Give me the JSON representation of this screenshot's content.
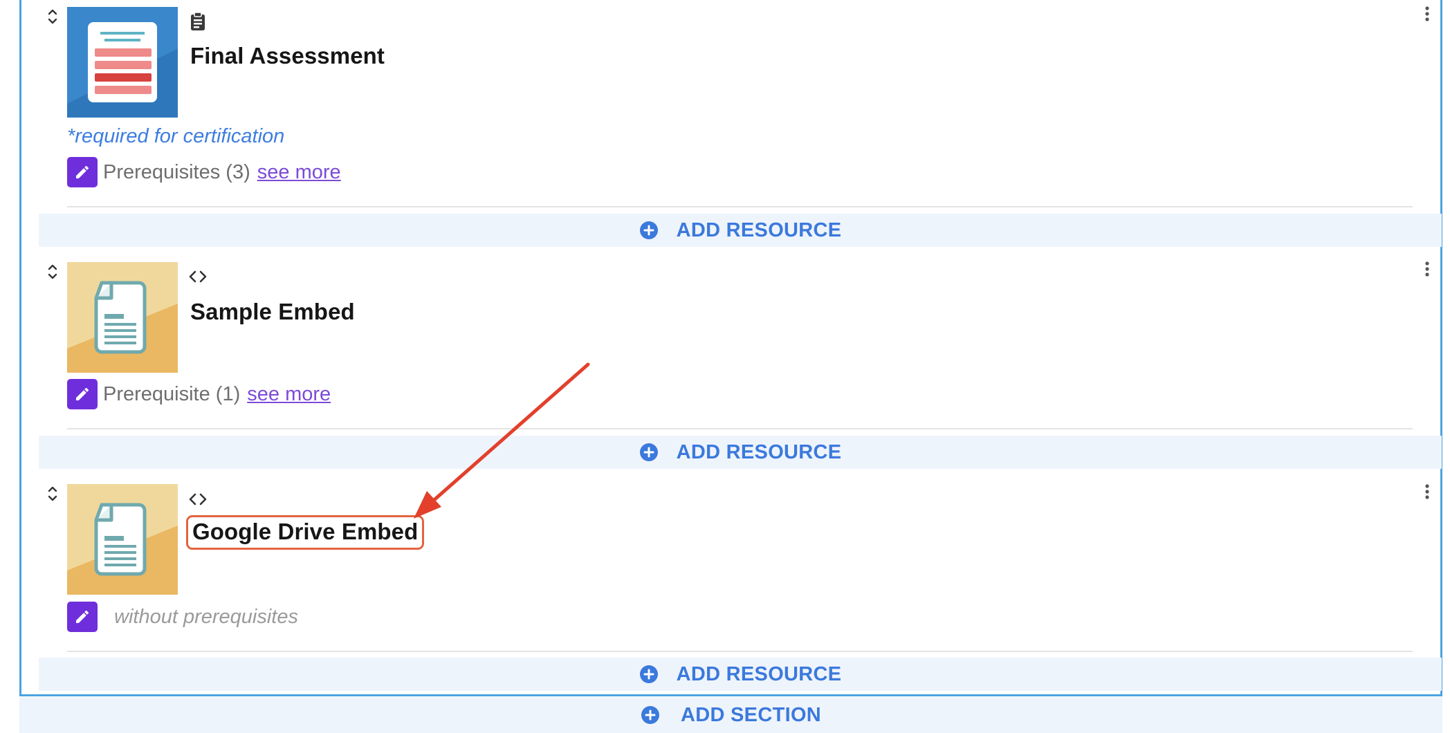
{
  "resources": [
    {
      "title": "Final Assessment",
      "type_icon": "clipboard-icon",
      "thumbnail": "assessment-thumbnail",
      "note": "*required for certification",
      "prereq_label": "Prerequisites (3)",
      "see_more": "see more"
    },
    {
      "title": "Sample Embed",
      "type_icon": "code-brackets-icon",
      "thumbnail": "document-thumbnail",
      "prereq_label": "Prerequisite (1)",
      "see_more": "see more"
    },
    {
      "title": "Google Drive Embed",
      "type_icon": "code-brackets-icon",
      "thumbnail": "document-thumbnail",
      "prereq_label": "without prerequisites"
    }
  ],
  "add_resource_label": "ADD RESOURCE",
  "add_section_label": "ADD SECTION",
  "colors": {
    "accent_blue": "#3b79dc",
    "edit_purple": "#6f2edb",
    "link_purple": "#7c4bd8",
    "frame_blue": "#4aa3df",
    "annotation_red": "#e2402c",
    "highlight_box": "#e2643f"
  }
}
